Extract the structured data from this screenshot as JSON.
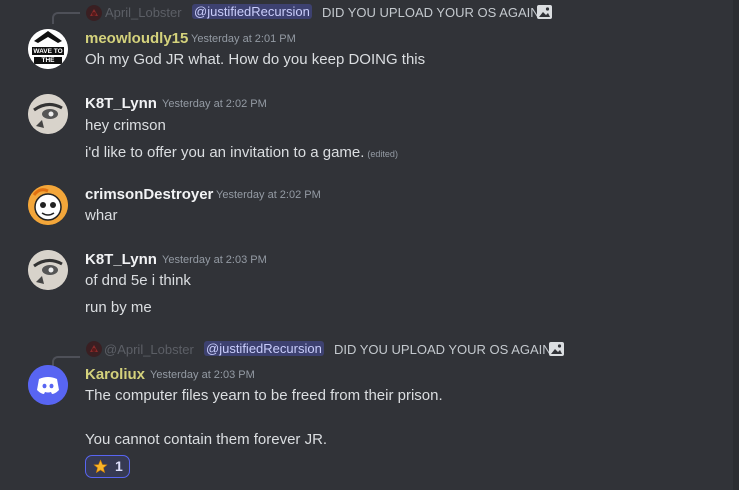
{
  "messages": [
    {
      "reply": {
        "name": "April_Lobster",
        "mention": "@justifiedRecursion",
        "text": "DID YOU UPLOAD YOUR OS AGAIN"
      },
      "user": "meowloudly15",
      "user_color": "#d4d27c",
      "timestamp": "Yesterday at 2:01 PM",
      "avatar_text": [
        "WAVE TO",
        "THE NSA"
      ],
      "lines": [
        "Oh my God JR what. How do you keep DOING this"
      ]
    },
    {
      "user": "K8T_Lynn",
      "user_color": "#f2f3f5",
      "timestamp": "Yesterday at 2:02 PM",
      "lines": [
        "hey crimson",
        "i'd like to offer you an invitation to a game."
      ],
      "edited": "(edited)"
    },
    {
      "user": "crimsonDestroyer",
      "user_color": "#f2f3f5",
      "timestamp": "Yesterday at 2:02 PM",
      "lines": [
        "whar"
      ]
    },
    {
      "user": "K8T_Lynn",
      "user_color": "#f2f3f5",
      "timestamp": "Yesterday at 2:03 PM",
      "lines": [
        "of dnd 5e i think",
        "run by me"
      ]
    },
    {
      "reply": {
        "name": "@April_Lobster",
        "mention": "@justifiedRecursion",
        "text": "DID YOU UPLOAD YOUR OS AGAIN"
      },
      "user": "Karoliux",
      "user_color": "#d4d27c",
      "timestamp": "Yesterday at 2:03 PM",
      "lines": [
        "The computer files yearn to be freed from their prison.",
        "You cannot contain them forever JR."
      ],
      "reaction": {
        "emoji": "star",
        "count": "1"
      }
    }
  ],
  "colors": {
    "background": "#313338",
    "mention_bg": "#3c4270",
    "discord_blurple": "#5865f2",
    "highlight_name": "#d4d27c"
  }
}
